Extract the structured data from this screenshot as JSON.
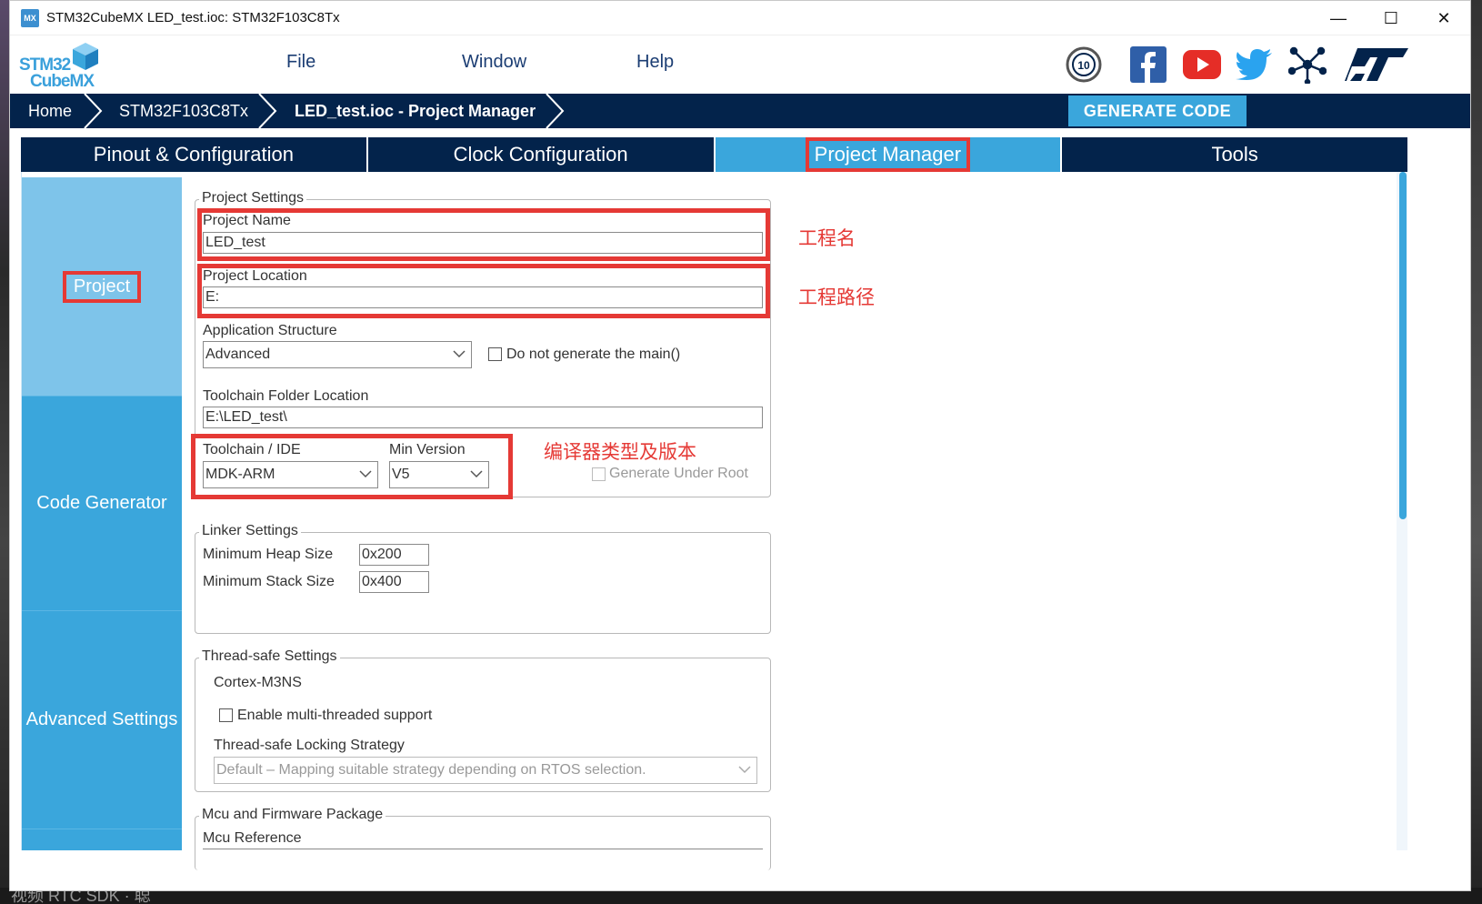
{
  "window": {
    "title": "STM32CubeMX LED_test.ioc: STM32F103C8Tx",
    "app_icon": "MX",
    "controls": {
      "minimize": "—",
      "maximize": "☐",
      "close": "✕"
    }
  },
  "logo": {
    "line1": "STM32",
    "line2": "CubeMX"
  },
  "menu": {
    "file": "File",
    "window": "Window",
    "help": "Help"
  },
  "social_icons": [
    "anniversary-10-icon",
    "facebook-icon",
    "youtube-icon",
    "twitter-icon",
    "network-icon",
    "st-logo-icon"
  ],
  "breadcrumb": {
    "home": "Home",
    "mcu": "STM32F103C8Tx",
    "current": "LED_test.ioc - Project Manager",
    "generate": "GENERATE CODE"
  },
  "tabs": {
    "pinout": "Pinout & Configuration",
    "clock": "Clock Configuration",
    "project_manager": "Project Manager",
    "tools": "Tools"
  },
  "sidenav": {
    "project": "Project",
    "code_generator": "Code Generator",
    "advanced": "Advanced Settings"
  },
  "project_settings": {
    "legend": "Project Settings",
    "name_label": "Project Name",
    "name_value": "LED_test",
    "location_label": "Project Location",
    "location_value": "E:",
    "app_structure_label": "Application Structure",
    "app_structure_value": "Advanced",
    "no_main_label": "Do not generate the main()",
    "toolchain_folder_label": "Toolchain Folder Location",
    "toolchain_folder_value": "E:\\LED_test\\",
    "toolchain_label": "Toolchain / IDE",
    "toolchain_value": "MDK-ARM",
    "min_version_label": "Min Version",
    "min_version_value": "V5",
    "generate_under_root": "Generate Under Root"
  },
  "linker_settings": {
    "legend": "Linker Settings",
    "heap_label": "Minimum Heap Size",
    "heap_value": "0x200",
    "stack_label": "Minimum Stack Size",
    "stack_value": "0x400"
  },
  "thread_safe": {
    "legend": "Thread-safe Settings",
    "core": "Cortex-M3NS",
    "enable_label": "Enable multi-threaded support",
    "strategy_label": "Thread-safe Locking Strategy",
    "strategy_value": "Default  –  Mapping suitable strategy depending on RTOS selection."
  },
  "mcu_firmware": {
    "legend": "Mcu and Firmware Package",
    "mcu_ref_label": "Mcu Reference"
  },
  "annotations": {
    "project_name": "工程名",
    "project_path": "工程路径",
    "compiler": "编译器类型及版本"
  },
  "background_text": "视频 RTC SDK  · 聪",
  "colors": {
    "navy": "#03234b",
    "accent_blue": "#3aa6dc",
    "light_blue": "#7ec4ea",
    "annotation_red": "#e53935"
  }
}
